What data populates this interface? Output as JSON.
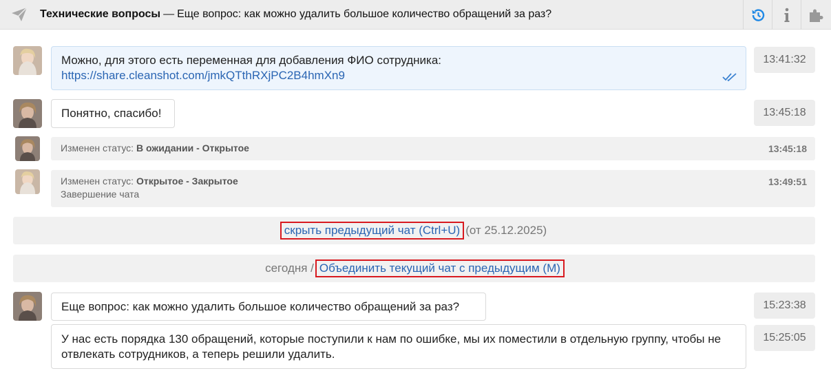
{
  "header": {
    "category": "Технические вопросы",
    "separator": "—",
    "subject": "Еще вопрос: как можно удалить большое количество обращений за раз?",
    "icons": [
      "send-icon",
      "history-icon",
      "info-icon",
      "puzzle-icon"
    ]
  },
  "messages": [
    {
      "text": "Можно, для этого есть переменная для добавления ФИО сотрудника:",
      "link": "https://share.cleanshot.com/jmkQTthRXjPC2B4hmXn9",
      "time": "13:41:32"
    },
    {
      "text": "Понятно, спасибо!",
      "time": "13:45:18"
    }
  ],
  "status_changes": [
    {
      "label": "Изменен статус:",
      "value": "В ожидании - Открытое",
      "time": "13:45:18"
    },
    {
      "label": "Изменен статус:",
      "value": "Открытое - Закрытое",
      "time": "13:49:51",
      "note": "Завершение чата"
    }
  ],
  "separators": {
    "hide_prev": {
      "link": "скрыть предыдущий чат (Ctrl+U)",
      "suffix": "(от 25.12.2025)"
    },
    "merge": {
      "prefix": "сегодня /",
      "link": "Объединить текущий чат с предыдущим (M)"
    }
  },
  "new_messages": [
    {
      "text": "Еще вопрос: как можно удалить большое количество обращений за раз?",
      "time": "15:23:38"
    },
    {
      "text": "У нас есть порядка 130 обращений, которые поступили к нам по ошибке, мы их поместили в отдельную группу, чтобы не отвлекать сотрудников, а теперь решили удалить.",
      "time": "15:25:05"
    }
  ],
  "colors": {
    "link": "#2a65b3",
    "highlight": "#d8191f",
    "accent": "#1e88e5"
  }
}
